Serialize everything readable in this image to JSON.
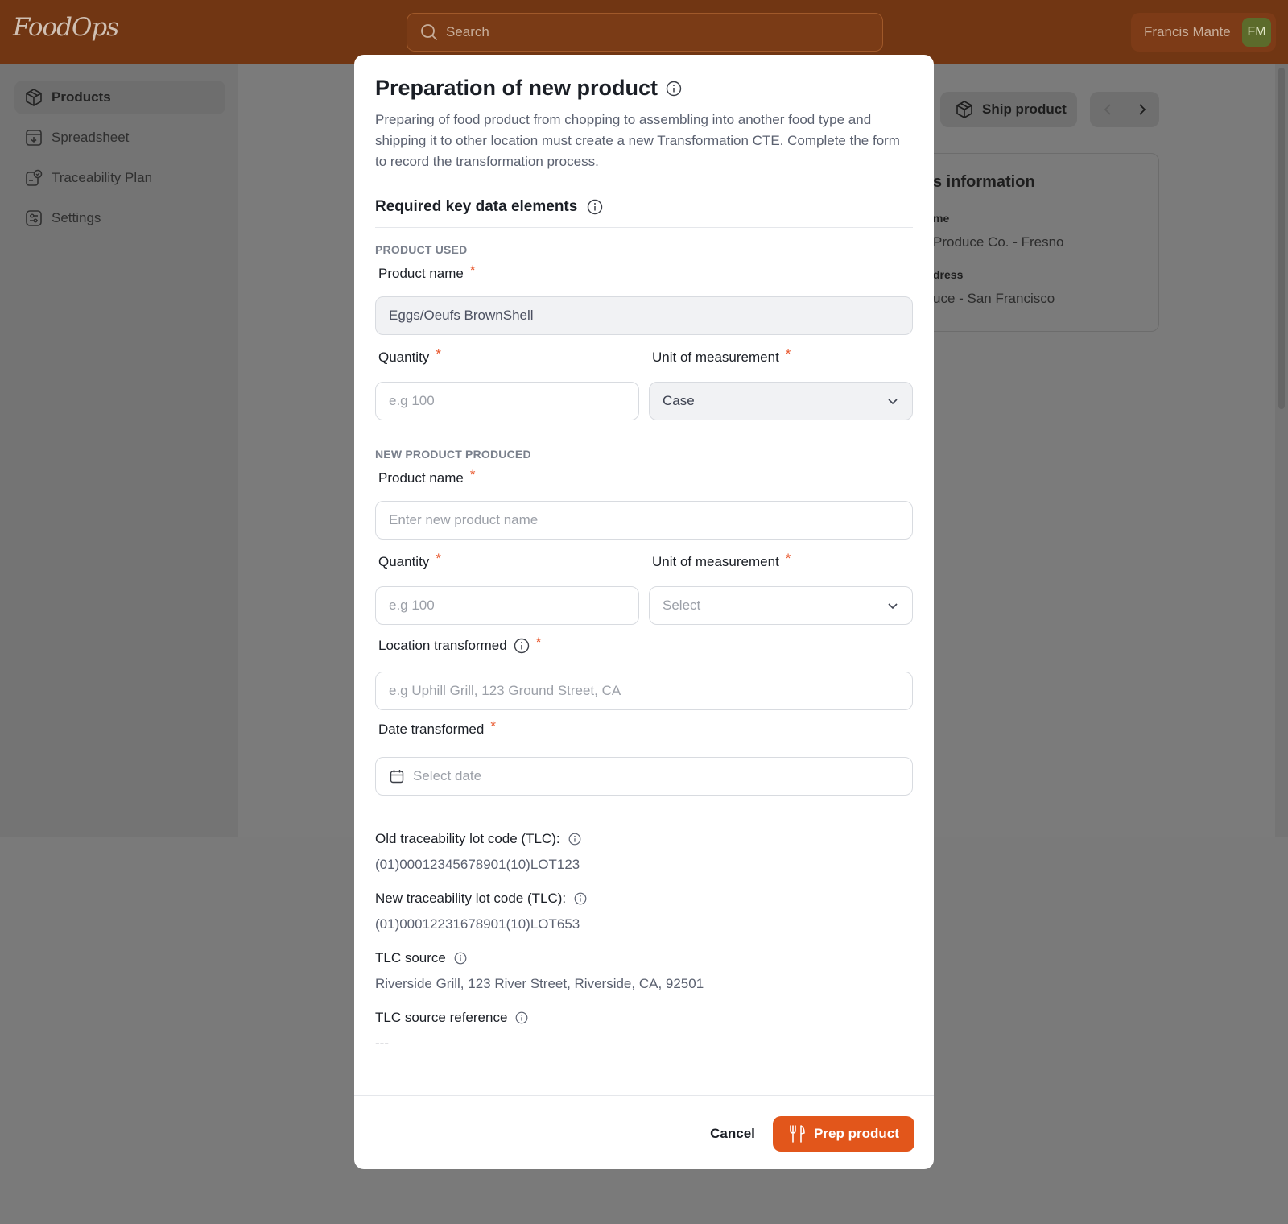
{
  "app": {
    "logo": "FoodOps"
  },
  "search": {
    "placeholder": "Search"
  },
  "user": {
    "name": "Francis Mante",
    "initials": "FM"
  },
  "sidebar": {
    "items": [
      {
        "label": "Products",
        "icon": "box-icon",
        "active": true
      },
      {
        "label": "Spreadsheet",
        "icon": "download-icon"
      },
      {
        "label": "Traceability Plan",
        "icon": "plan-icon"
      },
      {
        "label": "Settings",
        "icon": "settings-icon"
      }
    ]
  },
  "toolbar": {
    "ship_label": "Ship product"
  },
  "info_card": {
    "title": "s information",
    "field1_label": "me",
    "field1_value": "Produce Co. - Fresno",
    "field2_label": "dress",
    "field2_value": "uce - San Francisco"
  },
  "modal": {
    "title": "Preparation of new product",
    "description": "Preparing of food product from chopping to assembling into another food type and shipping it to other location must create a new Transformation CTE. Complete the form to record the transformation process.",
    "section_title": "Required key data elements",
    "product_used": {
      "group_label": "PRODUCT USED",
      "name_label": "Product name",
      "name_value": "Eggs/Oeufs BrownShell",
      "quantity_label": "Quantity",
      "quantity_placeholder": "e.g 100",
      "unit_label": "Unit of measurement",
      "unit_value": "Case"
    },
    "new_product": {
      "group_label": "NEW PRODUCT PRODUCED",
      "name_label": "Product name",
      "name_placeholder": "Enter new product name",
      "quantity_label": "Quantity",
      "quantity_placeholder": "e.g 100",
      "unit_label": "Unit of measurement",
      "unit_placeholder": "Select",
      "location_label": "Location transformed",
      "location_placeholder": "e.g Uphill Grill, 123 Ground Street, CA",
      "date_label": "Date transformed",
      "date_placeholder": "Select date"
    },
    "details": {
      "old_tlc_label": "Old traceability lot code (TLC):",
      "old_tlc_value": "(01)00012345678901(10)LOT123",
      "new_tlc_label": "New traceability lot code (TLC):",
      "new_tlc_value": "(01)00012231678901(10)LOT653",
      "tlc_source_label": "TLC source",
      "tlc_source_value": "Riverside Grill, 123 River Street, Riverside, CA, 92501",
      "tlc_ref_label": "TLC source reference",
      "tlc_ref_value": "---"
    },
    "required_mark": "*",
    "cancel_label": "Cancel",
    "submit_label": "Prep product"
  }
}
